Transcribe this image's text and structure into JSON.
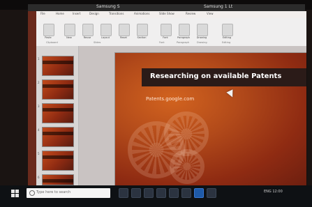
{
  "window": {
    "title_left": "Samsung S",
    "title_right": "Samsung 1 Lt"
  },
  "ribbon": {
    "tabs": [
      "File",
      "Home",
      "Insert",
      "Design",
      "Transitions",
      "Animations",
      "Slide Show",
      "Review",
      "View"
    ],
    "buttons": [
      {
        "label": "Paste"
      },
      {
        "label": "New"
      },
      {
        "label": "Reuse"
      },
      {
        "label": "Layout"
      },
      {
        "label": "Reset"
      },
      {
        "label": "Section"
      },
      {
        "label": "Font"
      },
      {
        "label": "Paragraph"
      },
      {
        "label": "Drawing"
      },
      {
        "label": "Editing"
      }
    ],
    "group_labels": [
      "Clipboard",
      "Slides",
      "Font",
      "Paragraph",
      "Drawing",
      "Editing"
    ]
  },
  "thumbnails": [
    {
      "num": "1"
    },
    {
      "num": "2"
    },
    {
      "num": "3"
    },
    {
      "num": "4"
    },
    {
      "num": "5"
    },
    {
      "num": "6"
    }
  ],
  "slide": {
    "title": "Researching on available Patents",
    "subtitle": "Patents.google.com"
  },
  "taskbar": {
    "search_placeholder": "Type here to search",
    "tray_text": "ENG  12:00"
  },
  "colors": {
    "ppt_accent": "#6a2a1c",
    "slide_bg": "#b24a1a",
    "taskbar": "#0e1114"
  }
}
